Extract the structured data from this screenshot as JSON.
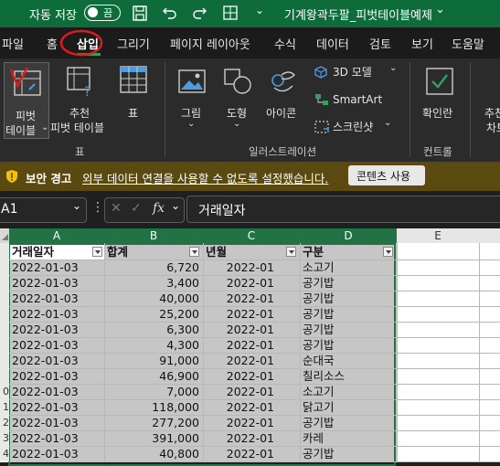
{
  "titlebar": {
    "autosave_label": "자동 저장",
    "autosave_state": "끔",
    "file_title": "기계왕곽두팔_피벗테이블예제"
  },
  "menu": {
    "tabs": [
      "파일",
      "홈",
      "삽입",
      "그리기",
      "페이지 레이아웃",
      "수식",
      "데이터",
      "검토",
      "보기",
      "도움말"
    ],
    "active_tab": "삽입"
  },
  "ribbon": {
    "pivot_table": [
      "피벗",
      "테이블"
    ],
    "recommended_pivot": [
      "추천",
      "피벗 테이블"
    ],
    "table": "표",
    "picture": "그림",
    "shapes": "도형",
    "icons": "아이콘",
    "model_3d": "3D 모델",
    "smartart": "SmartArt",
    "screenshot": "스크린샷",
    "checkbox": "확인란",
    "recommended_charts": [
      "추천",
      "차트"
    ],
    "group_tables": "표",
    "group_illustrations": "일러스트레이션",
    "group_controls": "컨트롤"
  },
  "security": {
    "title": "보안 경고",
    "message": "외부 데이터 연결을 사용할 수 없도록 설정했습니다.",
    "button": "콘텐츠 사용"
  },
  "formula_bar": {
    "name_box": "A1",
    "fx": "fx",
    "content": "거래일자"
  },
  "sheet": {
    "columns": [
      "A",
      "B",
      "C",
      "D",
      "E"
    ],
    "headers": [
      "거래일자",
      "합계",
      "년월",
      "구분"
    ],
    "row_numbers": [
      "",
      "",
      "",
      "",
      "",
      "",
      "",
      "",
      "0",
      "1",
      "2",
      "3",
      "4"
    ],
    "rows": [
      [
        "2022-01-03",
        "6,720",
        "2022-01",
        "소고기"
      ],
      [
        "2022-01-03",
        "3,400",
        "2022-01",
        "공기밥"
      ],
      [
        "2022-01-03",
        "40,000",
        "2022-01",
        "공기밥"
      ],
      [
        "2022-01-03",
        "25,200",
        "2022-01",
        "공기밥"
      ],
      [
        "2022-01-03",
        "6,300",
        "2022-01",
        "공기밥"
      ],
      [
        "2022-01-03",
        "4,300",
        "2022-01",
        "공기밥"
      ],
      [
        "2022-01-03",
        "91,000",
        "2022-01",
        "순대국"
      ],
      [
        "2022-01-03",
        "46,900",
        "2022-01",
        "칠리소스"
      ],
      [
        "2022-01-03",
        "7,000",
        "2022-01",
        "소고기"
      ],
      [
        "2022-01-03",
        "118,000",
        "2022-01",
        "닭고기"
      ],
      [
        "2022-01-03",
        "277,200",
        "2022-01",
        "공기밥"
      ],
      [
        "2022-01-03",
        "391,000",
        "2022-01",
        "카레"
      ],
      [
        "2022-01-03",
        "40,800",
        "2022-01",
        "공기밥"
      ]
    ]
  },
  "colors": {
    "titlebar": "#0e6b3a",
    "ribbon": "#2b2b2b",
    "security_bar": "#5a4a10",
    "selection": "#c6c6c6",
    "annotation_red": "#e11b1b"
  }
}
